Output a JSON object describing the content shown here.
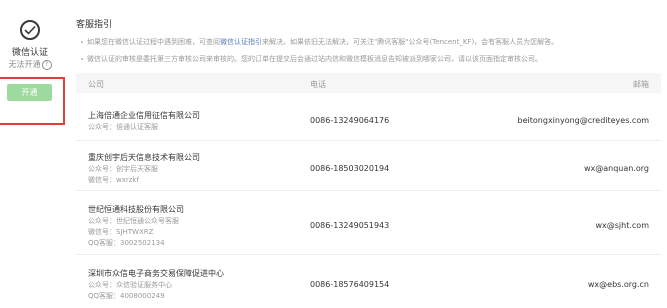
{
  "sidebar": {
    "title": "微信认证",
    "status": "无法开通",
    "help_glyph": "?",
    "open_button": "开通",
    "highlight_color": "#e43b3b"
  },
  "guide": {
    "title": "客服指引",
    "notes": [
      {
        "before": "如果您在微信认证过程中遇到困难，可查阅",
        "link": "微信认证指引",
        "after": "来解决。如果依旧无法解决，可关注\"腾讯客服\"公众号(Tencent_KF)，会有客服人员为您解答。"
      },
      {
        "before": "微信认证的审核是委托第三方审核公司来审核的。您的订单在提交后会通过站内信和微信模板消息告知被派到哪家公司，请以该页面指定审核公司。",
        "link": "",
        "after": ""
      }
    ]
  },
  "table": {
    "headers": {
      "company": "公司",
      "phone": "电话",
      "email": "邮箱"
    },
    "rows": [
      {
        "company": "上海倍通企业信用征信有限公司",
        "meta": [
          "公众号：倍通认证客服"
        ],
        "phone": "0086-13249064176",
        "email": "beitongxinyong@crediteyes.com"
      },
      {
        "company": "重庆创宇后天信息技术有限公司",
        "meta": [
          "公众号：创宇后天客服",
          "微信号：wxrzkf"
        ],
        "phone": "0086-18503020194",
        "email": "wx@anquan.org"
      },
      {
        "company": "世纪恒通科技股份有限公司",
        "meta": [
          "公众号：世纪恒通公众号客服",
          "微信号：SJHTWXRZ",
          "QQ客服：3002502134"
        ],
        "phone": "0086-13249051943",
        "email": "wx@sjht.com"
      },
      {
        "company": "深圳市众信电子商务交易保障促进中心",
        "meta": [
          "公众号：众信验证服务中心",
          "QQ客服：4008000249"
        ],
        "phone": "0086-18576409154",
        "email": "wx@ebs.org.cn"
      }
    ]
  }
}
